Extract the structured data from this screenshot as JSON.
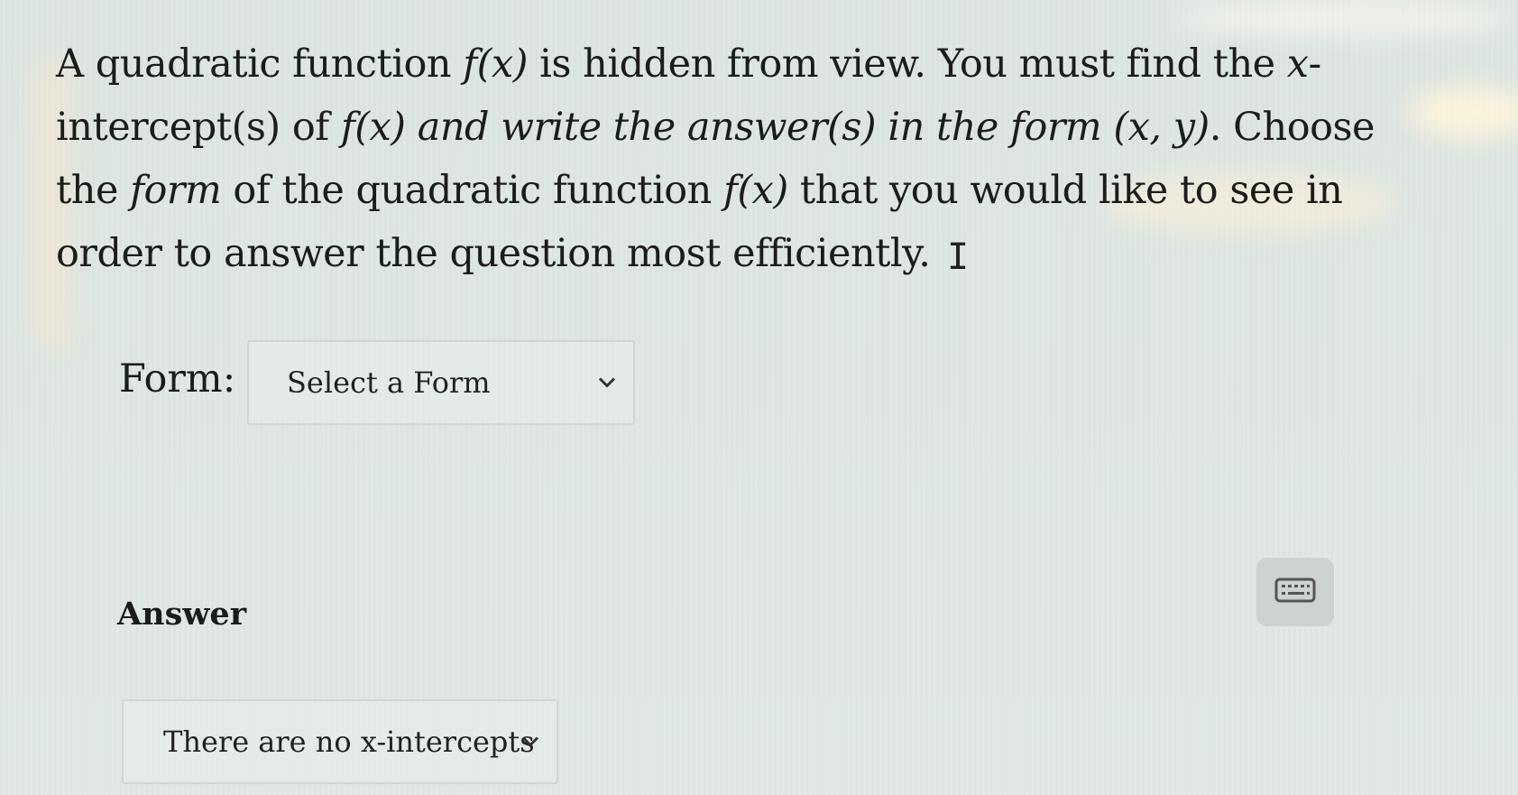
{
  "question": {
    "line1_a": "A quadratic function ",
    "line1_fx": "f(x)",
    "line1_b": " is hidden from view. You must find the ",
    "line1_x": "x",
    "line1_c": "-",
    "line2_a": "intercept(s) of ",
    "line2_fx": "f(x)",
    "line2_b": " and write the answer(s) in the form ",
    "line2_xy": "(x, y)",
    "line2_c": ". Choose",
    "line3_a": "the ",
    "line3_form": "form",
    "line3_b": " of the quadratic function ",
    "line3_fx": "f(x)",
    "line3_c": " that you would like to see in",
    "line4": "order to answer the question most efficiently."
  },
  "form_field": {
    "label": "Form:",
    "selected": "Select a Form"
  },
  "answer_field": {
    "label": "Answer",
    "selected": "There are no x-intercepts"
  },
  "icons": {
    "cursor": "text-cursor-icon",
    "keyboard": "keyboard-icon",
    "chevron": "chevron-down-icon"
  }
}
